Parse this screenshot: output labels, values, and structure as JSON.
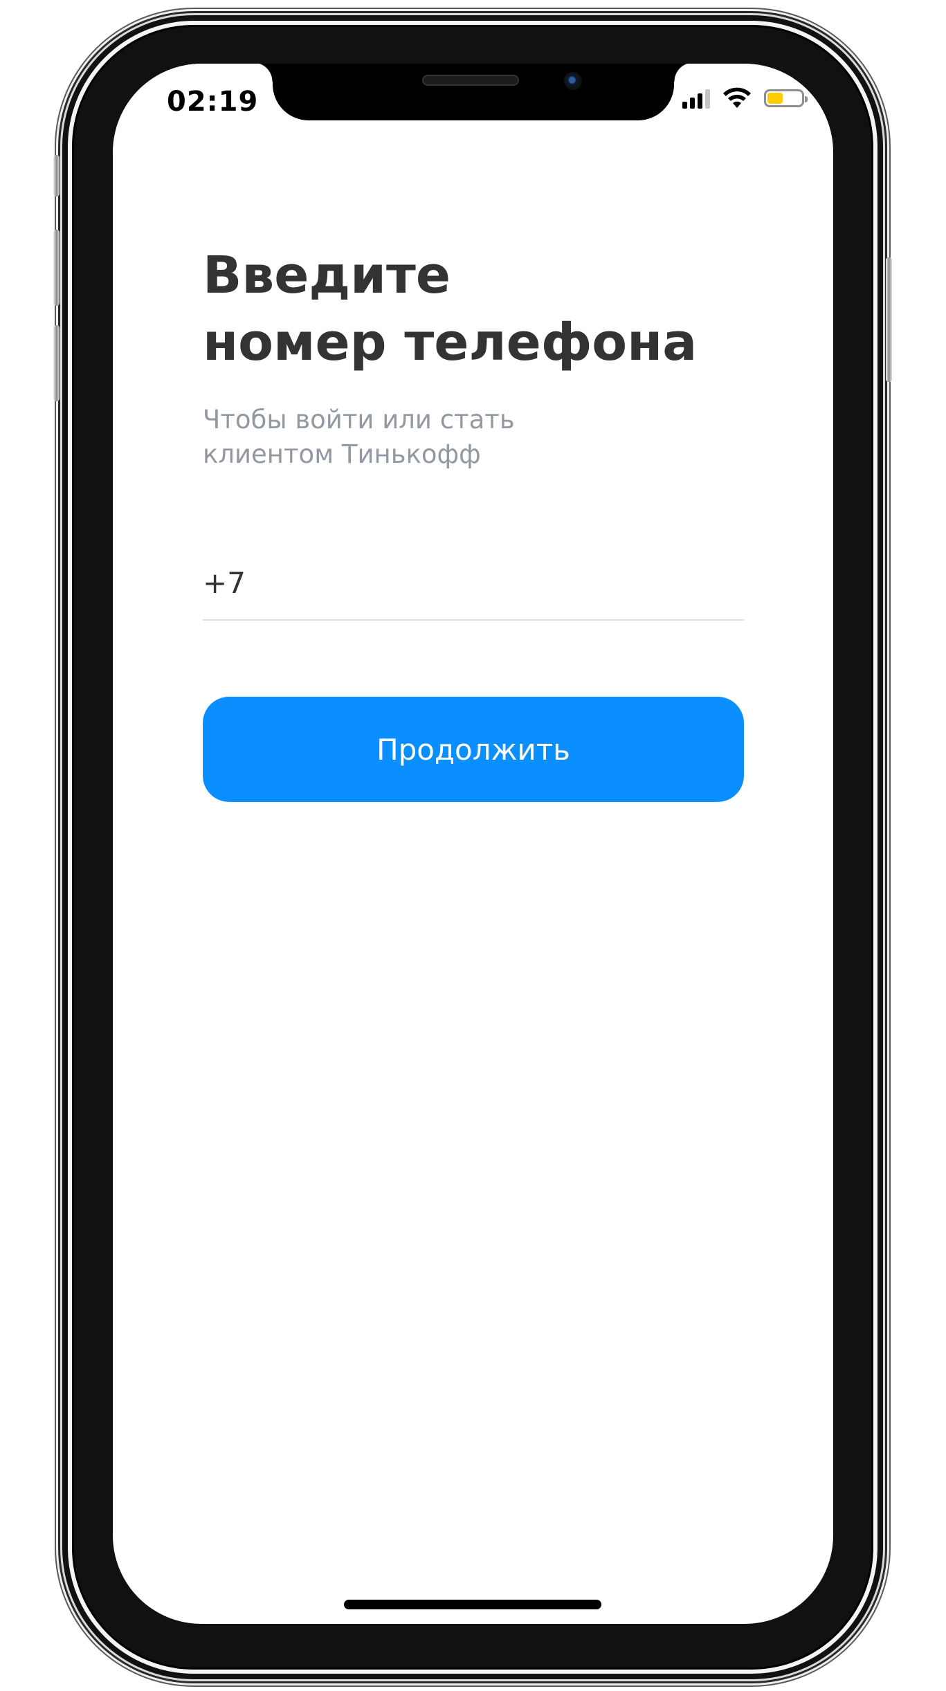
{
  "status_bar": {
    "time": "02:19",
    "signal_icon": "cellular-signal-icon",
    "wifi_icon": "wifi-icon",
    "battery_icon": "battery-icon",
    "battery_level": 0.45,
    "battery_color": "#FFCC00"
  },
  "login": {
    "title_line1": "Введите",
    "title_line2": "номер телефона",
    "subtitle_line1": "Чтобы войти или стать",
    "subtitle_line2": "клиентом Тинькофф",
    "phone_value": "+7",
    "continue_label": "Продолжить"
  },
  "colors": {
    "accent": "#0B8FFF",
    "title": "#333333",
    "subtitle": "#9299A2"
  }
}
